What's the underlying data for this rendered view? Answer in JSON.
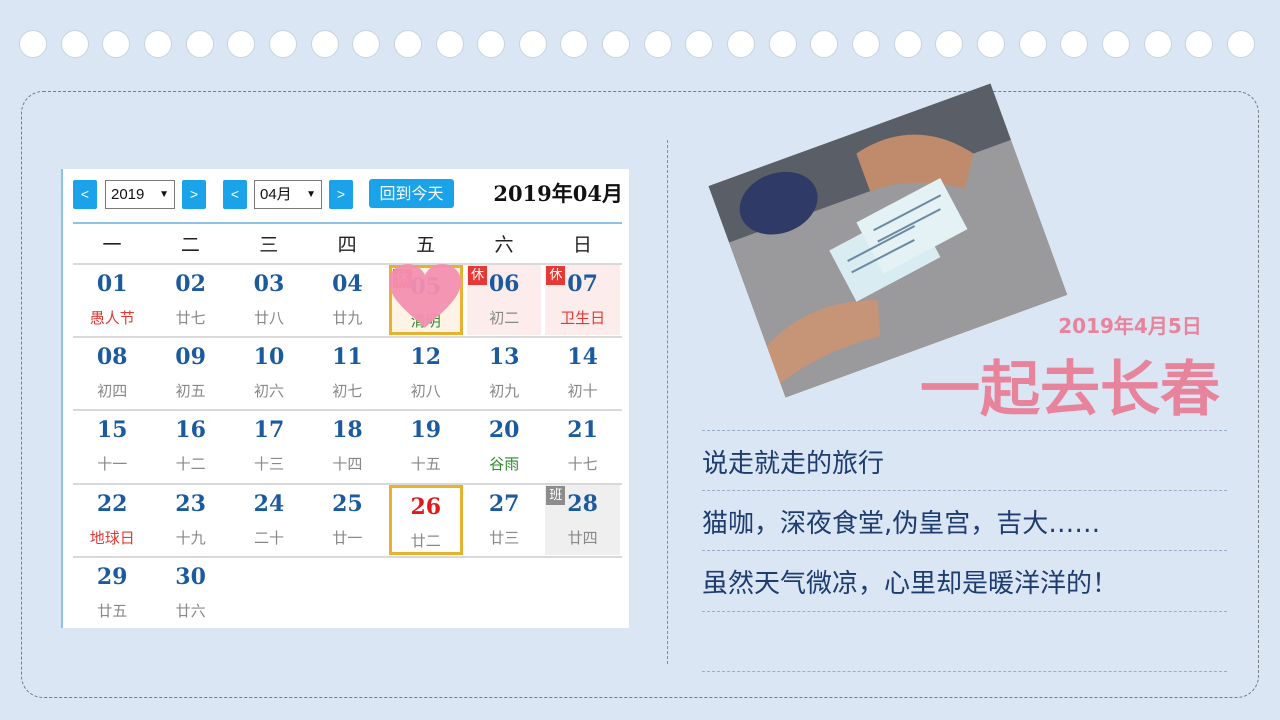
{
  "calendar": {
    "year_select": "2019",
    "month_select": "04月",
    "prev_symbol": "<",
    "next_symbol": ">",
    "dropdown_symbol": "▼",
    "today_button": "回到今天",
    "title": "2019年04月",
    "weekdays": [
      "一",
      "二",
      "三",
      "四",
      "五",
      "六",
      "日"
    ],
    "rest_badge": "休",
    "work_badge": "班",
    "rows": [
      [
        {
          "day": "01",
          "lunar": "愚人节",
          "lunar_color": "#e53935"
        },
        {
          "day": "02",
          "lunar": "廿七"
        },
        {
          "day": "03",
          "lunar": "廿八"
        },
        {
          "day": "04",
          "lunar": "廿九"
        },
        {
          "day": "05",
          "lunar": "清明",
          "lunar_color": "#2e8b2e"
        },
        {
          "day": "06",
          "lunar": "初二"
        },
        {
          "day": "07",
          "lunar": "卫生日",
          "lunar_color": "#e53935"
        }
      ],
      [
        {
          "day": "08",
          "lunar": "初四"
        },
        {
          "day": "09",
          "lunar": "初五"
        },
        {
          "day": "10",
          "lunar": "初六"
        },
        {
          "day": "11",
          "lunar": "初七"
        },
        {
          "day": "12",
          "lunar": "初八"
        },
        {
          "day": "13",
          "lunar": "初九"
        },
        {
          "day": "14",
          "lunar": "初十"
        }
      ],
      [
        {
          "day": "15",
          "lunar": "十一"
        },
        {
          "day": "16",
          "lunar": "十二"
        },
        {
          "day": "17",
          "lunar": "十三"
        },
        {
          "day": "18",
          "lunar": "十四"
        },
        {
          "day": "19",
          "lunar": "十五"
        },
        {
          "day": "20",
          "lunar": "谷雨",
          "lunar_color": "#2e8b2e"
        },
        {
          "day": "21",
          "lunar": "十七"
        }
      ],
      [
        {
          "day": "22",
          "lunar": "地球日",
          "lunar_color": "#e53935"
        },
        {
          "day": "23",
          "lunar": "十九"
        },
        {
          "day": "24",
          "lunar": "二十"
        },
        {
          "day": "25",
          "lunar": "廿一"
        },
        {
          "day": "26",
          "lunar": "廿二"
        },
        {
          "day": "27",
          "lunar": "廿三"
        },
        {
          "day": "28",
          "lunar": "廿四"
        }
      ],
      [
        {
          "day": "29",
          "lunar": "廿五"
        },
        {
          "day": "30",
          "lunar": "廿六"
        }
      ]
    ],
    "accent_color": "#1aa3e8",
    "heart_color": "#f48fb1"
  },
  "story": {
    "date": "2019年4月5日",
    "title": "一起去长春",
    "lines": [
      "说走就走的旅行",
      "猫咖，深夜食堂,伪皇宫，吉大……",
      "虽然天气微凉，心里却是暖洋洋的！"
    ],
    "accent_color": "#e8839c"
  }
}
